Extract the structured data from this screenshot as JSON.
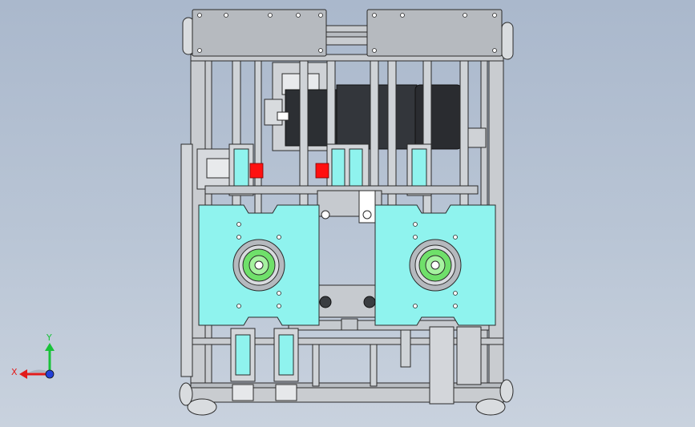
{
  "viewport": {
    "background_top": "#aab8cc",
    "background_bottom": "#c9d2de"
  },
  "colors": {
    "frame": "#c9ccd0",
    "frame_edge": "#2a2a2a",
    "plate_cyan": "#8ff3ee",
    "motor_dark": "#2c2f33",
    "bearing_green": "#6fe06a",
    "alarm_red": "#ff1010",
    "axis_x": "#e21b1b",
    "axis_y": "#19c23a",
    "axis_origin": "#2340d8"
  },
  "triad": {
    "x_label": "X",
    "y_label": "Y"
  }
}
